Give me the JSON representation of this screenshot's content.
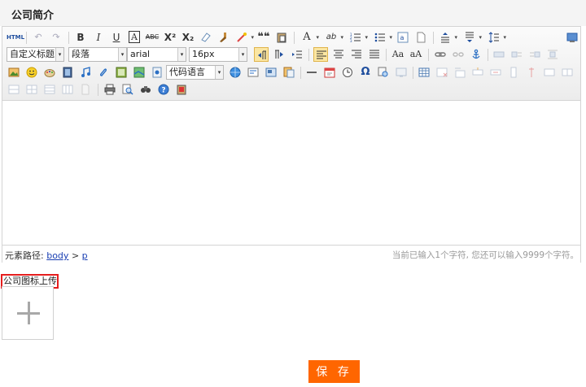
{
  "section": {
    "title": "公司简介"
  },
  "toolbar": {
    "row1": {
      "html": "HTML",
      "bold": "B",
      "italic": "I",
      "underline": "U",
      "fontborder": "A",
      "strike": "ABC",
      "sup": "X²",
      "sub": "X₂",
      "blockquote": "❝❝",
      "fontcolor": "A",
      "bgcolor": "ab"
    },
    "custom_style": "自定义标题",
    "paragraph": "段落",
    "font_family": "arial",
    "font_size": "16px",
    "code_language": "代码语言",
    "omega": "Ω"
  },
  "statusbar": {
    "path_label": "元素路径:",
    "path_body": "body",
    "path_sep": ">",
    "path_p": "p",
    "count_text": "当前已输入1个字符, 您还可以输入9999个字符。"
  },
  "upload": {
    "label": "公司图标上传:"
  },
  "save": {
    "label": "保 存"
  }
}
